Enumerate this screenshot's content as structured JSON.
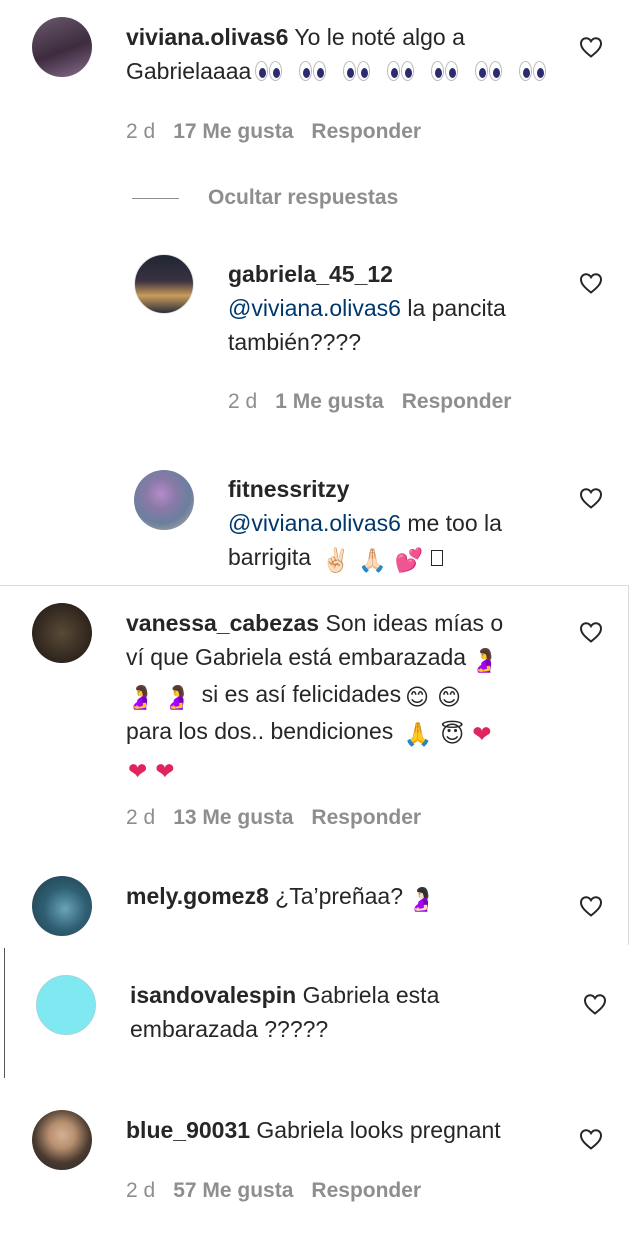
{
  "comments": [
    {
      "username": "viviana.olivas6",
      "text_prefix": "Yo le noté algo a",
      "text_line2": "Gabrielaaaa",
      "time": "2 d",
      "likes": "17 Me gusta",
      "reply": "Responder",
      "avatar_colors": [
        "#3d2b3e",
        "#8a6f8e"
      ]
    },
    {
      "username": "gabriela_45_12",
      "mention": "@viviana.olivas6",
      "text_rest": "la pancita",
      "text_line2": "también????",
      "time": "2 d",
      "likes": "1 Me gusta",
      "reply": "Responder",
      "avatar_colors": [
        "#2a2f3a",
        "#c99b5c"
      ]
    },
    {
      "username": "fitnessritzy",
      "mention": "@viviana.olivas6",
      "text_rest": "me too la",
      "text_line2": "barrigita",
      "avatar_colors": [
        "#6b7f9e",
        "#b58cc9"
      ]
    },
    {
      "username": "vanessa_cabezas",
      "text_line1": "Son ideas mías o",
      "text_line2": "ví que Gabriela está embarazada",
      "text_line3": "si es así felicidades",
      "text_line4": "para los dos.. bendiciones",
      "time": "2 d",
      "likes": "13 Me gusta",
      "reply": "Responder",
      "avatar_colors": [
        "#2d241c",
        "#5a4a36"
      ]
    },
    {
      "username": "mely.gomez8",
      "text": "¿Ta’preñaa?",
      "avatar_colors": [
        "#1f3a4a",
        "#6aa3b8"
      ]
    },
    {
      "username": "isandovalespin",
      "text_line1": "Gabriela esta",
      "text_line2": "embarazada ?????",
      "avatar_colors": [
        "#7fe8f0",
        "#7fe8f0"
      ]
    },
    {
      "username": "blue_90031",
      "text": "Gabriela looks pregnant",
      "time": "2 d",
      "likes": "57 Me gusta",
      "reply": "Responder",
      "avatar_colors": [
        "#2a2622",
        "#b89070"
      ]
    }
  ],
  "hide_replies": "Ocultar respuestas",
  "icons": {
    "like": "heart-outline-icon",
    "eyes": "eyes-emoji-icon",
    "pregnant": "pregnant-woman-emoji-icon",
    "smile": "smiling-face-emoji-icon",
    "pray": "folded-hands-emoji-icon",
    "angel": "angel-face-emoji-icon",
    "red_heart": "red-heart-emoji-icon",
    "victory": "victory-hand-emoji-icon",
    "two_hearts": "two-hearts-emoji-icon"
  },
  "colors": {
    "text": "#262626",
    "muted": "#8e8e8e",
    "mention": "#00376b",
    "red": "#e0245e"
  }
}
